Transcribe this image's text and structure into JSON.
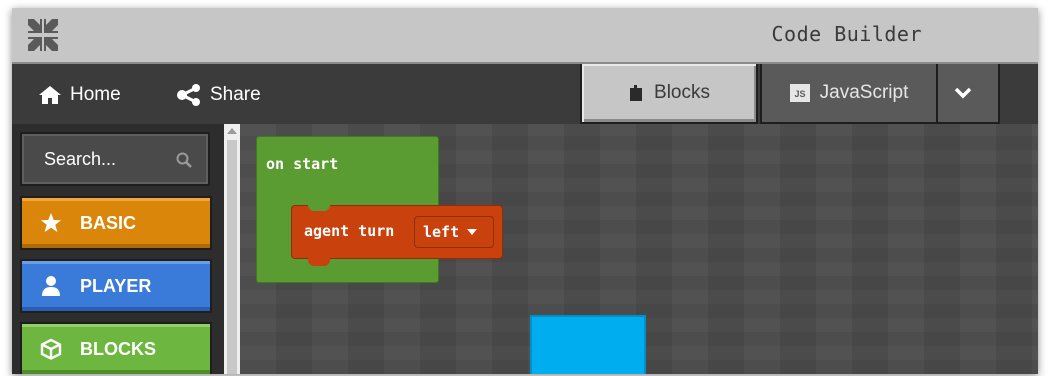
{
  "window": {
    "title": "Code Builder"
  },
  "toolbar": {
    "home_label": "Home",
    "share_label": "Share",
    "tabs": [
      {
        "label": "Blocks",
        "icon": "puzzle-icon",
        "active": true
      },
      {
        "label": "JavaScript",
        "icon": "js-icon",
        "active": false
      }
    ],
    "more_icon": "chevron-down-icon"
  },
  "palette": {
    "search_placeholder": "Search...",
    "categories": [
      {
        "label": "BASIC",
        "icon": "star-icon",
        "color": "#d9860a"
      },
      {
        "label": "PLAYER",
        "icon": "user-icon",
        "color": "#3a7ad9"
      },
      {
        "label": "BLOCKS",
        "icon": "cube-icon",
        "color": "#6db63f"
      }
    ]
  },
  "workspace": {
    "on_start_label": "on start",
    "agent_turn_label": "agent turn",
    "agent_turn_direction": "left",
    "colors": {
      "event_block": "#5a9b32",
      "agent_block": "#c9410c",
      "blue_block": "#00aeef"
    }
  }
}
